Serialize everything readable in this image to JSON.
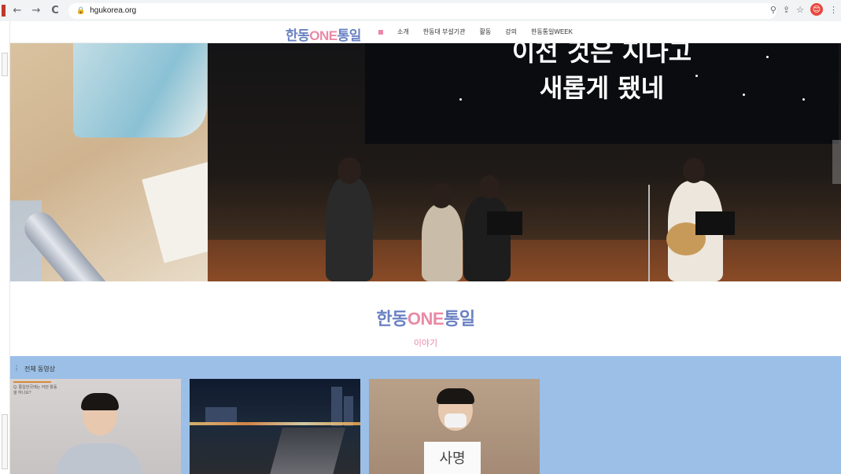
{
  "browser": {
    "url": "hgukorea.org",
    "back_icon": "←",
    "forward_icon": "→",
    "reload_icon": "C",
    "lock_icon": "🔒",
    "right_icons": [
      "⚲",
      "⇪",
      "☆"
    ],
    "avatar_initial": "😊",
    "menu_icon": "⋮"
  },
  "header": {
    "logo_part1": "한동",
    "logo_part2": "ONE",
    "logo_part3": "통일",
    "nav": [
      "소개",
      "한동대 부설기관",
      "활동",
      "강의",
      "한동통일WEEK"
    ]
  },
  "hero": {
    "line1": "이전 것은 지나고",
    "line2": "새롭게 됐네"
  },
  "section": {
    "logo_part1": "한동",
    "logo_part2": "ONE",
    "logo_part3": "통일",
    "subtitle": "이야기"
  },
  "videos": {
    "label_icon": "⋮",
    "label": "전체 동영상",
    "thumb1_caption": "Q. 통일한국에는 어떤 활동을 하나요?",
    "thumb3_sign": "사명"
  },
  "colors": {
    "brand_blue": "#6a82c3",
    "brand_pink": "#e88aa6",
    "video_bg": "#9bbfe6"
  }
}
